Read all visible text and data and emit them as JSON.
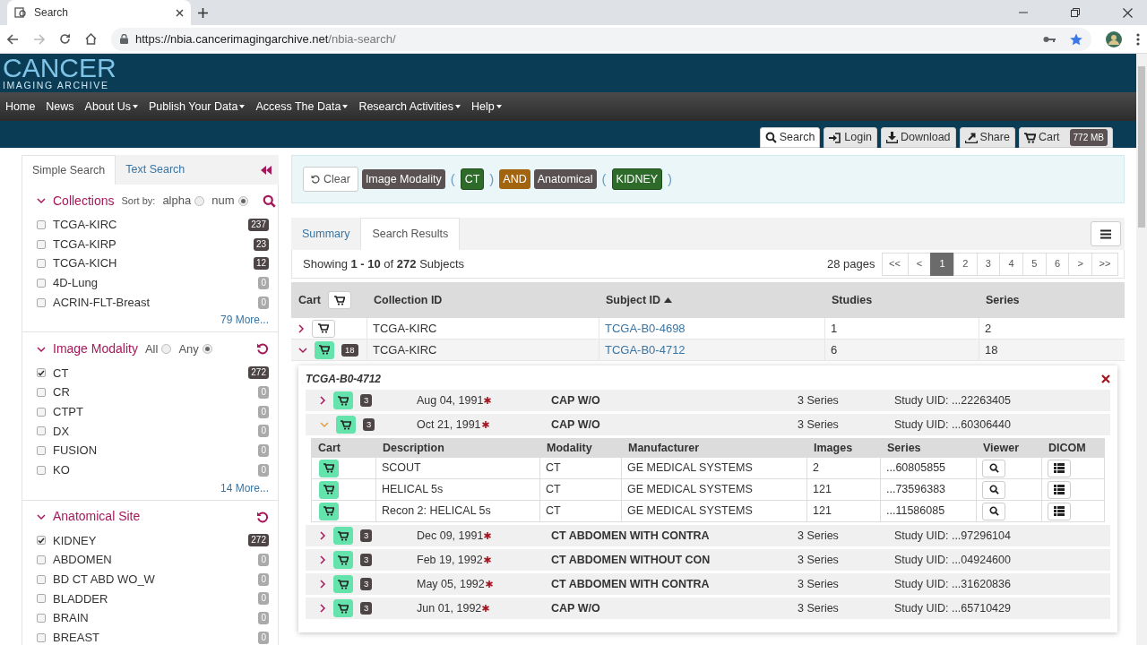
{
  "browser": {
    "tab_title": "Search",
    "url_host": "https://nbia.cancerimagingarchive.net",
    "url_path": "/nbia-search/"
  },
  "logo": {
    "line1": "CANCER",
    "line2": "IMAGING ARCHIVE"
  },
  "nav": [
    {
      "label": "Home",
      "dropdown": false
    },
    {
      "label": "News",
      "dropdown": false
    },
    {
      "label": "About Us",
      "dropdown": true
    },
    {
      "label": "Publish Your Data",
      "dropdown": true
    },
    {
      "label": "Access The Data",
      "dropdown": true
    },
    {
      "label": "Research Activities",
      "dropdown": true
    },
    {
      "label": "Help",
      "dropdown": true
    }
  ],
  "toolbar": [
    {
      "kind": "search",
      "label": "Search",
      "selected": true
    },
    {
      "kind": "login",
      "label": "Login",
      "selected": false
    },
    {
      "kind": "download",
      "label": "Download",
      "selected": false
    },
    {
      "kind": "share",
      "label": "Share",
      "selected": false
    },
    {
      "kind": "cart",
      "label": "Cart",
      "selected": false,
      "badge": "772 MB"
    }
  ],
  "sidebar": {
    "tabs": [
      {
        "label": "Simple Search",
        "selected": true
      },
      {
        "label": "Text Search",
        "selected": false
      }
    ],
    "sections": [
      {
        "title": "Collections",
        "expanded": true,
        "sort_label": "Sort by:",
        "kind": "search",
        "radios": [
          {
            "label": "alpha",
            "selected": false
          },
          {
            "label": "num",
            "selected": true
          }
        ],
        "more": "79 More...",
        "items": [
          {
            "label": "TCGA-KIRC",
            "checked": false,
            "count": "237",
            "available": true
          },
          {
            "label": "TCGA-KIRP",
            "checked": false,
            "count": "23",
            "available": true
          },
          {
            "label": "TCGA-KICH",
            "checked": false,
            "count": "12",
            "available": true
          },
          {
            "label": "4D-Lung",
            "checked": false,
            "count": "0",
            "available": false
          },
          {
            "label": "ACRIN-FLT-Breast",
            "checked": false,
            "count": "0",
            "available": false
          }
        ]
      },
      {
        "title": "Image Modality",
        "expanded": true,
        "kind": "reset",
        "radios": [
          {
            "label": "All",
            "selected": false
          },
          {
            "label": "Any",
            "selected": true
          }
        ],
        "more": "14 More...",
        "items": [
          {
            "label": "CT",
            "checked": true,
            "count": "272",
            "available": true
          },
          {
            "label": "CR",
            "checked": false,
            "count": "0",
            "available": false
          },
          {
            "label": "CTPT",
            "checked": false,
            "count": "0",
            "available": false
          },
          {
            "label": "DX",
            "checked": false,
            "count": "0",
            "available": false
          },
          {
            "label": "FUSION",
            "checked": false,
            "count": "0",
            "available": false
          },
          {
            "label": "KO",
            "checked": false,
            "count": "0",
            "available": false
          }
        ]
      },
      {
        "title": "Anatomical Site",
        "expanded": true,
        "kind": "reset",
        "items": [
          {
            "label": "KIDNEY",
            "checked": true,
            "count": "272",
            "available": true
          },
          {
            "label": "ABDOMEN",
            "checked": false,
            "count": "0",
            "available": false
          },
          {
            "label": "BD CT ABD WO_W",
            "checked": false,
            "count": "0",
            "available": false
          },
          {
            "label": "BLADDER",
            "checked": false,
            "count": "0",
            "available": false
          },
          {
            "label": "BRAIN",
            "checked": false,
            "count": "0",
            "available": false
          },
          {
            "label": "BREAST",
            "checked": false,
            "count": "0",
            "available": false
          }
        ]
      }
    ]
  },
  "query": {
    "clear": "Clear",
    "tokens": [
      {
        "kind": "field",
        "text": "Image Modality"
      },
      {
        "kind": "paren",
        "text": "("
      },
      {
        "kind": "value",
        "text": "CT"
      },
      {
        "kind": "paren",
        "text": ")"
      },
      {
        "kind": "op",
        "text": "AND"
      },
      {
        "kind": "field",
        "text": "Anatomical"
      },
      {
        "kind": "paren",
        "text": "("
      },
      {
        "kind": "value",
        "text": "KIDNEY"
      },
      {
        "kind": "paren",
        "text": ")"
      }
    ]
  },
  "results": {
    "tabs": [
      {
        "label": "Summary",
        "selected": false
      },
      {
        "label": "Search Results",
        "selected": true
      }
    ],
    "showing": "Showing **1 - 10** of **272** Subjects",
    "pages": "28 pages",
    "pager": [
      {
        "label": "<<",
        "selected": false
      },
      {
        "label": "<",
        "selected": false
      },
      {
        "label": "1",
        "selected": true
      },
      {
        "label": "2",
        "selected": false
      },
      {
        "label": "3",
        "selected": false
      },
      {
        "label": "4",
        "selected": false
      },
      {
        "label": "5",
        "selected": false
      },
      {
        "label": "6",
        "selected": false
      },
      {
        "label": ">",
        "selected": false
      },
      {
        "label": ">>",
        "selected": false
      }
    ],
    "columns": [
      "Cart",
      "Collection ID",
      "Subject ID",
      "Studies",
      "Series"
    ],
    "rows": [
      {
        "expanded": false,
        "in_cart": false,
        "collection": "TCGA-KIRC",
        "subject": "TCGA-B0-4698",
        "studies": "1",
        "series": "2"
      },
      {
        "expanded": true,
        "in_cart": true,
        "cart_count": "18",
        "collection": "TCGA-KIRC",
        "subject": "TCGA-B0-4712",
        "studies": "6",
        "series": "18"
      }
    ],
    "detail": {
      "title": "TCGA-B0-4712",
      "series_columns": [
        "Cart",
        "Description",
        "Modality",
        "Manufacturer",
        "Images",
        "Series",
        "Viewer",
        "DICOM"
      ],
      "studies": [
        {
          "expanded": false,
          "cart_count": "3",
          "date": "Aug 04, 1991",
          "description": "CAP W/O",
          "series_count": "3 Series",
          "uid": "Study UID: ...22263405"
        },
        {
          "expanded": true,
          "cart_count": "3",
          "date": "Oct 21, 1991",
          "description": "CAP W/O",
          "series_count": "3 Series",
          "uid": "Study UID: ...60306440",
          "series": [
            {
              "description": "SCOUT",
              "modality": "CT",
              "manufacturer": "GE MEDICAL SYSTEMS",
              "images": "2",
              "series": "...60805855"
            },
            {
              "description": "HELICAL 5s",
              "modality": "CT",
              "manufacturer": "GE MEDICAL SYSTEMS",
              "images": "121",
              "series": "...73596383"
            },
            {
              "description": "Recon 2: HELICAL 5s",
              "modality": "CT",
              "manufacturer": "GE MEDICAL SYSTEMS",
              "images": "121",
              "series": "...11586085"
            }
          ]
        },
        {
          "expanded": false,
          "cart_count": "3",
          "date": "Dec 09, 1991",
          "description": "CT ABDOMEN WITH CONTRA",
          "series_count": "3 Series",
          "uid": "Study UID: ...97296104"
        },
        {
          "expanded": false,
          "cart_count": "3",
          "date": "Feb 19, 1992",
          "description": "CT ABDOMEN WITHOUT CON",
          "series_count": "3 Series",
          "uid": "Study UID: ...04924600"
        },
        {
          "expanded": false,
          "cart_count": "3",
          "date": "May 05, 1992",
          "description": "CT ABDOMEN WITH CONTRA",
          "series_count": "3 Series",
          "uid": "Study UID: ...31620836"
        },
        {
          "expanded": false,
          "cart_count": "3",
          "date": "Jun 01, 1992",
          "description": "CAP W/O",
          "series_count": "3 Series",
          "uid": "Study UID: ...65710429"
        }
      ]
    }
  }
}
